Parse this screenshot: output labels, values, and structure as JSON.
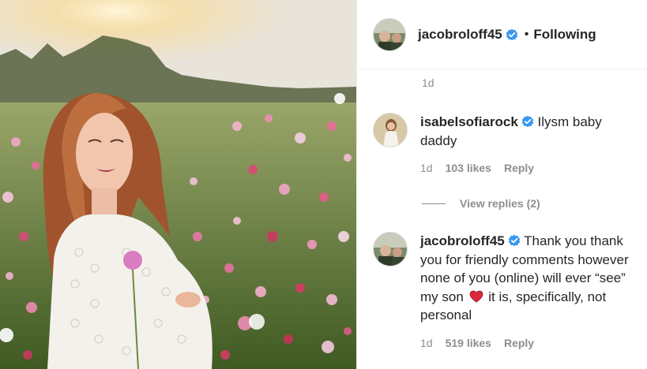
{
  "post": {
    "photo_icon": "post-photo",
    "header": {
      "username": "jacobroloff45",
      "separator": "•",
      "follow_status": "Following"
    },
    "caption_time": "1d"
  },
  "comments": [
    {
      "username": "isabelsofiarock",
      "text": "Ilysm baby daddy",
      "time": "1d",
      "likes": "103 likes",
      "reply": "Reply"
    },
    {
      "username": "jacobroloff45",
      "text_before": "Thank you thank you for friendly comments however none of you (online) will ever “see” my son",
      "text_after": "it is, specifically, not personal",
      "emoji": "red-heart",
      "time": "1d",
      "likes": "519 likes",
      "reply": "Reply"
    }
  ],
  "view_replies": "View replies (2)",
  "colors": {
    "verified": "#3897f0",
    "muted": "#8e8e8e",
    "text": "#262626",
    "heart": "#e0263a"
  }
}
